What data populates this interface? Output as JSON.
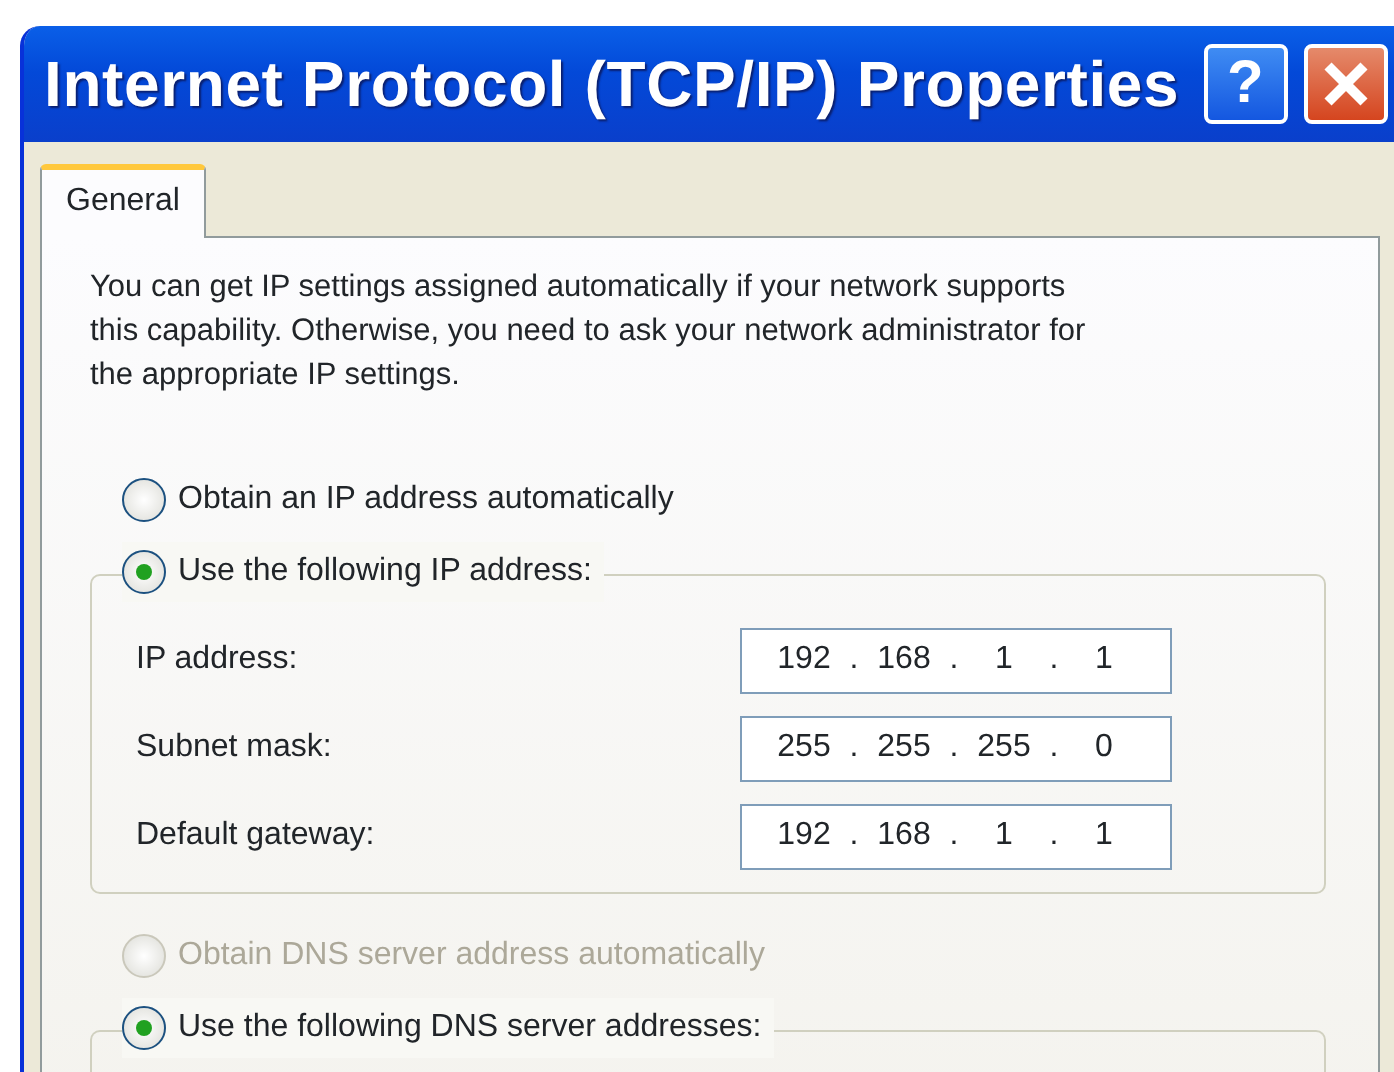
{
  "window": {
    "title": "Internet Protocol (TCP/IP) Properties",
    "help_button": "?"
  },
  "tabs": [
    {
      "label": "General",
      "selected": true
    }
  ],
  "description_lines": [
    "You can get IP settings assigned automatically if your network supports",
    "this capability. Otherwise, you need to ask your network administrator for",
    "the appropriate IP settings."
  ],
  "ip_options": [
    {
      "label": "Obtain an IP address automatically",
      "selected": false,
      "disabled": false
    },
    {
      "label": "Use the following IP address:",
      "selected": true,
      "disabled": false
    }
  ],
  "ip_fields": [
    {
      "label": "IP address:",
      "octets": [
        "192",
        "168",
        "1",
        "1"
      ],
      "separator": "."
    },
    {
      "label": "Subnet mask:",
      "octets": [
        "255",
        "255",
        "255",
        "0"
      ],
      "separator": "."
    },
    {
      "label": "Default gateway:",
      "octets": [
        "192",
        "168",
        "1",
        "1"
      ],
      "separator": "."
    }
  ],
  "dns_options": [
    {
      "label": "Obtain DNS server address automatically",
      "selected": false,
      "disabled": true
    },
    {
      "label": "Use the following DNS server addresses:",
      "selected": true,
      "disabled": false
    }
  ]
}
